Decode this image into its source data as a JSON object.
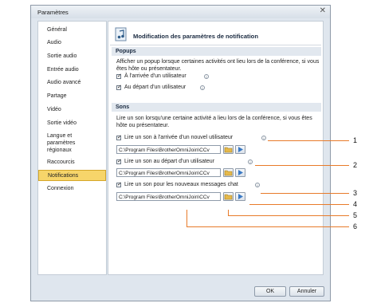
{
  "window": {
    "title": "Paramètres",
    "close_glyph": "✕"
  },
  "sidebar": {
    "items": [
      {
        "label": "Général"
      },
      {
        "label": "Audio"
      },
      {
        "label": "Sortie audio"
      },
      {
        "label": "Entrée audio"
      },
      {
        "label": "Audio avancé"
      },
      {
        "label": "Partage"
      },
      {
        "label": "Vidéo"
      },
      {
        "label": "Sortie vidéo"
      },
      {
        "label": "Langue et paramètres régionaux"
      },
      {
        "label": "Raccourcis"
      },
      {
        "label": "Notifications"
      },
      {
        "label": "Connexion"
      }
    ],
    "selected_index": 10
  },
  "panel": {
    "header_title": "Modification des paramètres de notification",
    "popups": {
      "heading": "Popups",
      "description": "Afficher un popup lorsque certaines activités ont lieu lors de la conférence, si vous êtes hôte ou présentateur.",
      "options": [
        {
          "label": "À l'arrivée d'un utilisateur",
          "checked": true
        },
        {
          "label": "Au départ d'un utilisateur",
          "checked": true
        }
      ]
    },
    "sons": {
      "heading": "Sons",
      "description": "Lire un son lorsqu'une certaine activité a lieu lors de la conférence, si vous êtes hôte ou présentateur.",
      "options": [
        {
          "label": "Lire un son à l'arrivée d'un nouvel utilisateur",
          "checked": true,
          "path": "C:\\Program Files\\BrotherOmniJoin\\CCv"
        },
        {
          "label": "Lire un son au départ d'un utilisateur",
          "checked": true,
          "path": "C:\\Program Files\\BrotherOmniJoin\\CCv"
        },
        {
          "label": "Lire un son pour les nouveaux messages chat",
          "checked": true,
          "path": "C:\\Program Files\\BrotherOmniJoin\\CCv"
        }
      ]
    }
  },
  "buttons": {
    "ok": "OK",
    "cancel": "Annuler"
  },
  "callouts": [
    "1",
    "2",
    "3",
    "4",
    "5",
    "6"
  ],
  "colors": {
    "accent": "#e87b2a",
    "selection": "#f7d56a",
    "section_bar": "#e2e8ef"
  },
  "icons": [
    "notification-settings-icon",
    "info-icon",
    "folder-browse-icon",
    "play-icon",
    "close-icon"
  ]
}
